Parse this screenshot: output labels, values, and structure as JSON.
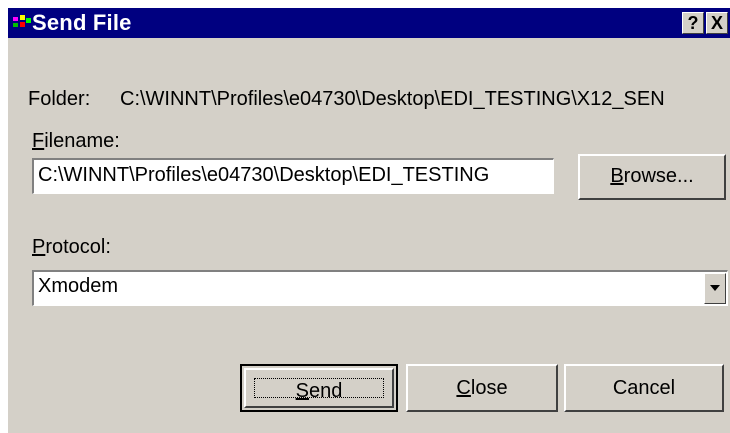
{
  "window": {
    "title": "Send File",
    "help_glyph": "?",
    "close_glyph": "X",
    "app_icon": "app-icon"
  },
  "folder": {
    "label": "Folder:",
    "value": "C:\\WINNT\\Profiles\\e04730\\Desktop\\EDI_TESTING\\X12_SEN"
  },
  "filename": {
    "label_accel": "F",
    "label_rest": "ilename:",
    "value": "C:\\WINNT\\Profiles\\e04730\\Desktop\\EDI_TESTING"
  },
  "browse_button": {
    "label_accel": "B",
    "label_rest": "rowse..."
  },
  "protocol": {
    "label_accel": "P",
    "label_rest": "rotocol:",
    "selected": "Xmodem"
  },
  "buttons": {
    "send_accel": "S",
    "send_rest": "end",
    "close_accel": "C",
    "close_rest": "lose",
    "cancel": "Cancel"
  },
  "colors": {
    "titlebar": "#000080",
    "face": "#d4d0c8"
  }
}
